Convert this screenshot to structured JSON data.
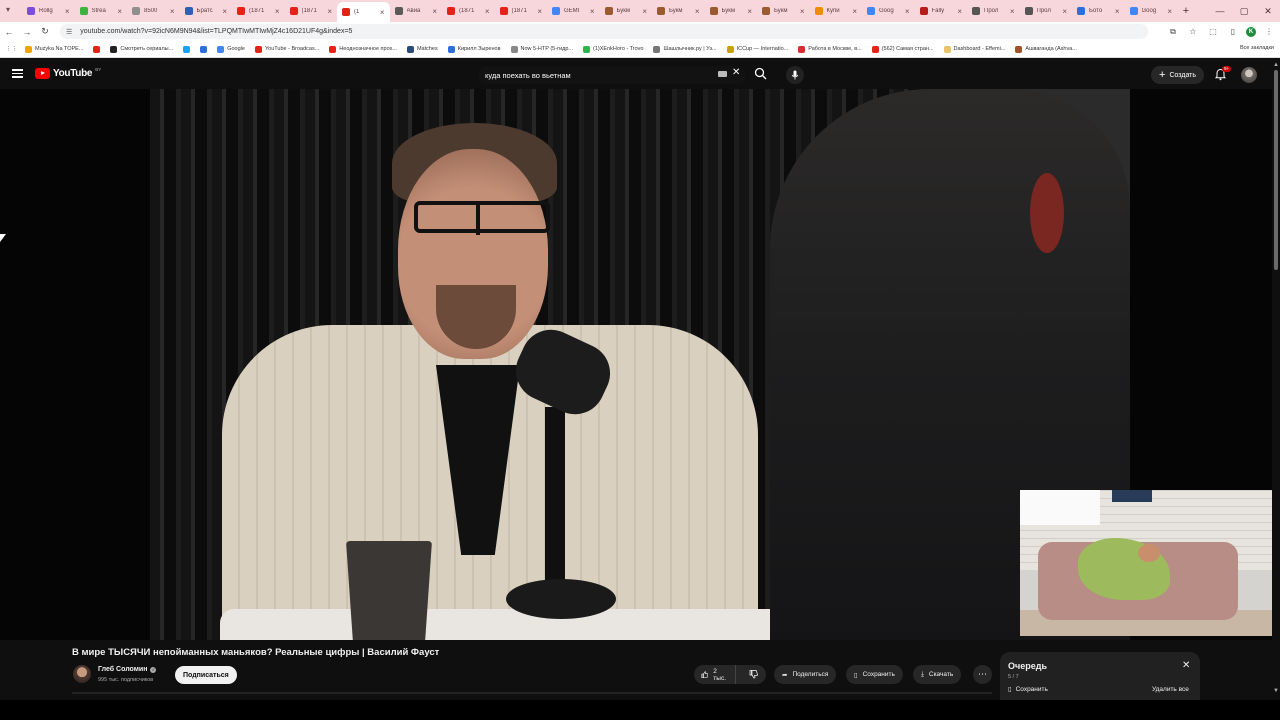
{
  "browser": {
    "tabs": [
      {
        "title": "Rollg",
        "color": "#7b4ddc"
      },
      {
        "title": "Strea",
        "color": "#3db33d"
      },
      {
        "title": "8500",
        "color": "#8f8f8f"
      },
      {
        "title": "Братс",
        "color": "#2e5fb5"
      },
      {
        "title": "(1871",
        "color": "#e62117"
      },
      {
        "title": "(1871",
        "color": "#e62117"
      },
      {
        "title": "(1",
        "color": "#e62117",
        "active": true
      },
      {
        "title": "Авиа",
        "color": "#5a5a5a"
      },
      {
        "title": "(1871",
        "color": "#e62117"
      },
      {
        "title": "(1871",
        "color": "#e62117"
      },
      {
        "title": "GEMI",
        "color": "#4285f4"
      },
      {
        "title": "Букм",
        "color": "#9b5a2f"
      },
      {
        "title": "Букм",
        "color": "#9b5a2f"
      },
      {
        "title": "Букм",
        "color": "#9b5a2f"
      },
      {
        "title": "Букм",
        "color": "#9b5a2f"
      },
      {
        "title": "Купи",
        "color": "#f08c00"
      },
      {
        "title": "Goog",
        "color": "#4285f4"
      },
      {
        "title": "Fally",
        "color": "#b71c1c"
      },
      {
        "title": "Прол",
        "color": "#555555"
      },
      {
        "title": "Прол",
        "color": "#555555"
      },
      {
        "title": "Бото",
        "color": "#2a6fdb"
      },
      {
        "title": "Goog",
        "color": "#4285f4"
      }
    ],
    "url": "youtube.com/watch?v=92icN6M9N94&list=TLPQMTIwMTIwMjZ4c16D21UF4g&index=5",
    "profile_initial": "K",
    "bookmarks": [
      {
        "title": "Muzyka Na TOPE...",
        "color": "#f0a500"
      },
      {
        "title": "",
        "color": "#e62117"
      },
      {
        "title": "Смотреть сериалы...",
        "color": "#222222"
      },
      {
        "title": "",
        "color": "#1da1f2"
      },
      {
        "title": "",
        "color": "#2a6fdb"
      },
      {
        "title": "Google",
        "color": "#4285f4"
      },
      {
        "title": "YouTube - Broadcas...",
        "color": "#e62117"
      },
      {
        "title": "Неоднозначное прох...",
        "color": "#e62117"
      },
      {
        "title": "Matches",
        "color": "#2b4a7a"
      },
      {
        "title": "Кирилл Зыренов",
        "color": "#2a6fdb"
      },
      {
        "title": "Now 5-HTP (5-гидр...",
        "color": "#888888"
      },
      {
        "title": "(1)XEnkHoro - Trovo",
        "color": "#2fb34d"
      },
      {
        "title": "Шашлычник.ру | Уз...",
        "color": "#777777"
      },
      {
        "title": "ICCup — Internatio...",
        "color": "#c8a200"
      },
      {
        "title": "Работа в Москве, в...",
        "color": "#d32f2f"
      },
      {
        "title": "(562) Самая стран...",
        "color": "#e62117"
      },
      {
        "title": "Dashboard - Effemi...",
        "color": "#e9c46a"
      },
      {
        "title": "Ашваганда (Ashva...",
        "color": "#a0522d"
      }
    ],
    "all_bookmarks": "Все закладки"
  },
  "youtube": {
    "logo_text": "YouTube",
    "country_code": "BY",
    "search_query": "куда поехать во вьетнам",
    "create_label": "Создать",
    "notifications_badge": "9+"
  },
  "video": {
    "title": "В мире ТЫСЯЧИ непойманных маньяков? Реальные цифры | Василий Фауст",
    "channel_name": "Глеб Соломин",
    "subscribers": "995 тыс. подписчиков",
    "subscribe_label": "Подписаться",
    "likes": "2 тыс.",
    "share_label": "Поделиться",
    "save_label": "Сохранить",
    "download_label": "Скачать"
  },
  "queue": {
    "title": "Очередь",
    "count": "5 / 7",
    "save_label": "Сохранить",
    "clear_label": "Удалить все"
  }
}
